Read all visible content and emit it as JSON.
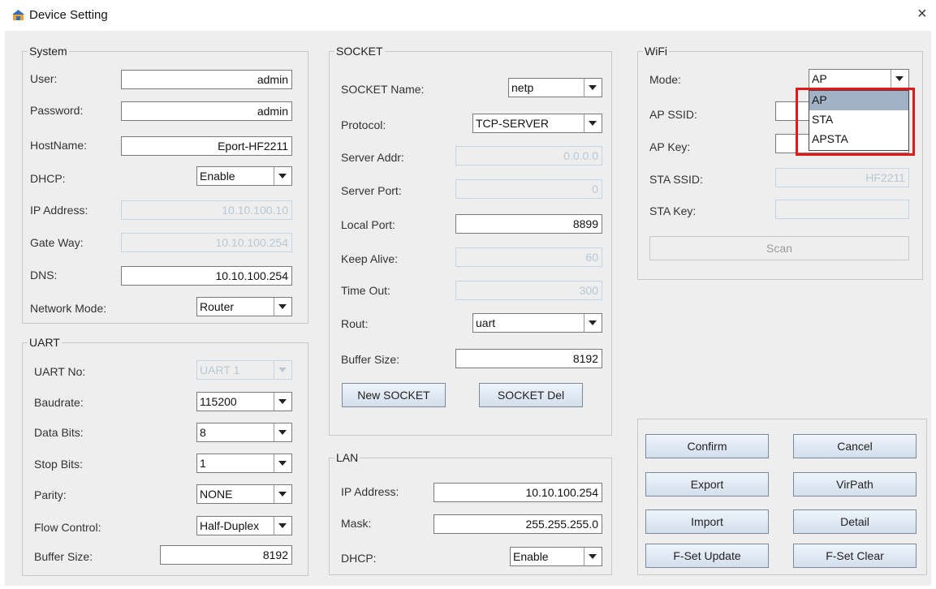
{
  "window": {
    "title": "Device Setting",
    "close_glyph": "×"
  },
  "system": {
    "legend": "System",
    "user_label": "User:",
    "user_value": "admin",
    "password_label": "Password:",
    "password_value": "admin",
    "hostname_label": "HostName:",
    "hostname_value": "Eport-HF2211",
    "dhcp_label": "DHCP:",
    "dhcp_value": "Enable",
    "ip_label": "IP Address:",
    "ip_value": "10.10.100.10",
    "gateway_label": "Gate Way:",
    "gateway_value": "10.10.100.254",
    "dns_label": "DNS:",
    "dns_value": "10.10.100.254",
    "netmode_label": "Network Mode:",
    "netmode_value": "Router"
  },
  "uart": {
    "legend": "UART",
    "uartno_label": "UART No:",
    "uartno_value": "UART 1",
    "baud_label": "Baudrate:",
    "baud_value": "115200",
    "databits_label": "Data Bits:",
    "databits_value": "8",
    "stopbits_label": "Stop Bits:",
    "stopbits_value": "1",
    "parity_label": "Parity:",
    "parity_value": "NONE",
    "flow_label": "Flow Control:",
    "flow_value": "Half-Duplex",
    "buffer_label": "Buffer Size:",
    "buffer_value": "8192"
  },
  "socket": {
    "legend": "SOCKET",
    "name_label": "SOCKET Name:",
    "name_value": "netp",
    "protocol_label": "Protocol:",
    "protocol_value": "TCP-SERVER",
    "serveraddr_label": "Server Addr:",
    "serveraddr_value": "0.0.0.0",
    "serverport_label": "Server Port:",
    "serverport_value": "0",
    "localport_label": "Local Port:",
    "localport_value": "8899",
    "keepalive_label": "Keep Alive:",
    "keepalive_value": "60",
    "timeout_label": "Time Out:",
    "timeout_value": "300",
    "rout_label": "Rout:",
    "rout_value": "uart",
    "buffer_label": "Buffer Size:",
    "buffer_value": "8192",
    "new_button": "New SOCKET",
    "del_button": "SOCKET Del"
  },
  "lan": {
    "legend": "LAN",
    "ip_label": "IP Address:",
    "ip_value": "10.10.100.254",
    "mask_label": "Mask:",
    "mask_value": "255.255.255.0",
    "dhcp_label": "DHCP:",
    "dhcp_value": "Enable"
  },
  "wifi": {
    "legend": "WiFi",
    "mode_label": "Mode:",
    "mode_value": "AP",
    "ap_ssid_label": "AP SSID:",
    "ap_key_label": "AP Key:",
    "sta_ssid_label": "STA SSID:",
    "sta_ssid_value": "HF2211",
    "sta_key_label": "STA Key:",
    "sta_key_value": "",
    "scan_button": "Scan",
    "mode_options": [
      "AP",
      "STA",
      "APSTA"
    ],
    "selected_option": "AP"
  },
  "actions": {
    "confirm": "Confirm",
    "cancel": "Cancel",
    "export": "Export",
    "virpath": "VirPath",
    "import": "Import",
    "detail": "Detail",
    "fset_update": "F-Set Update",
    "fset_clear": "F-Set Clear"
  },
  "colors": {
    "highlight_box": "#e01a1a",
    "dropdown_selected": "#a2b2c6",
    "panel_bg": "#eeeeee"
  }
}
